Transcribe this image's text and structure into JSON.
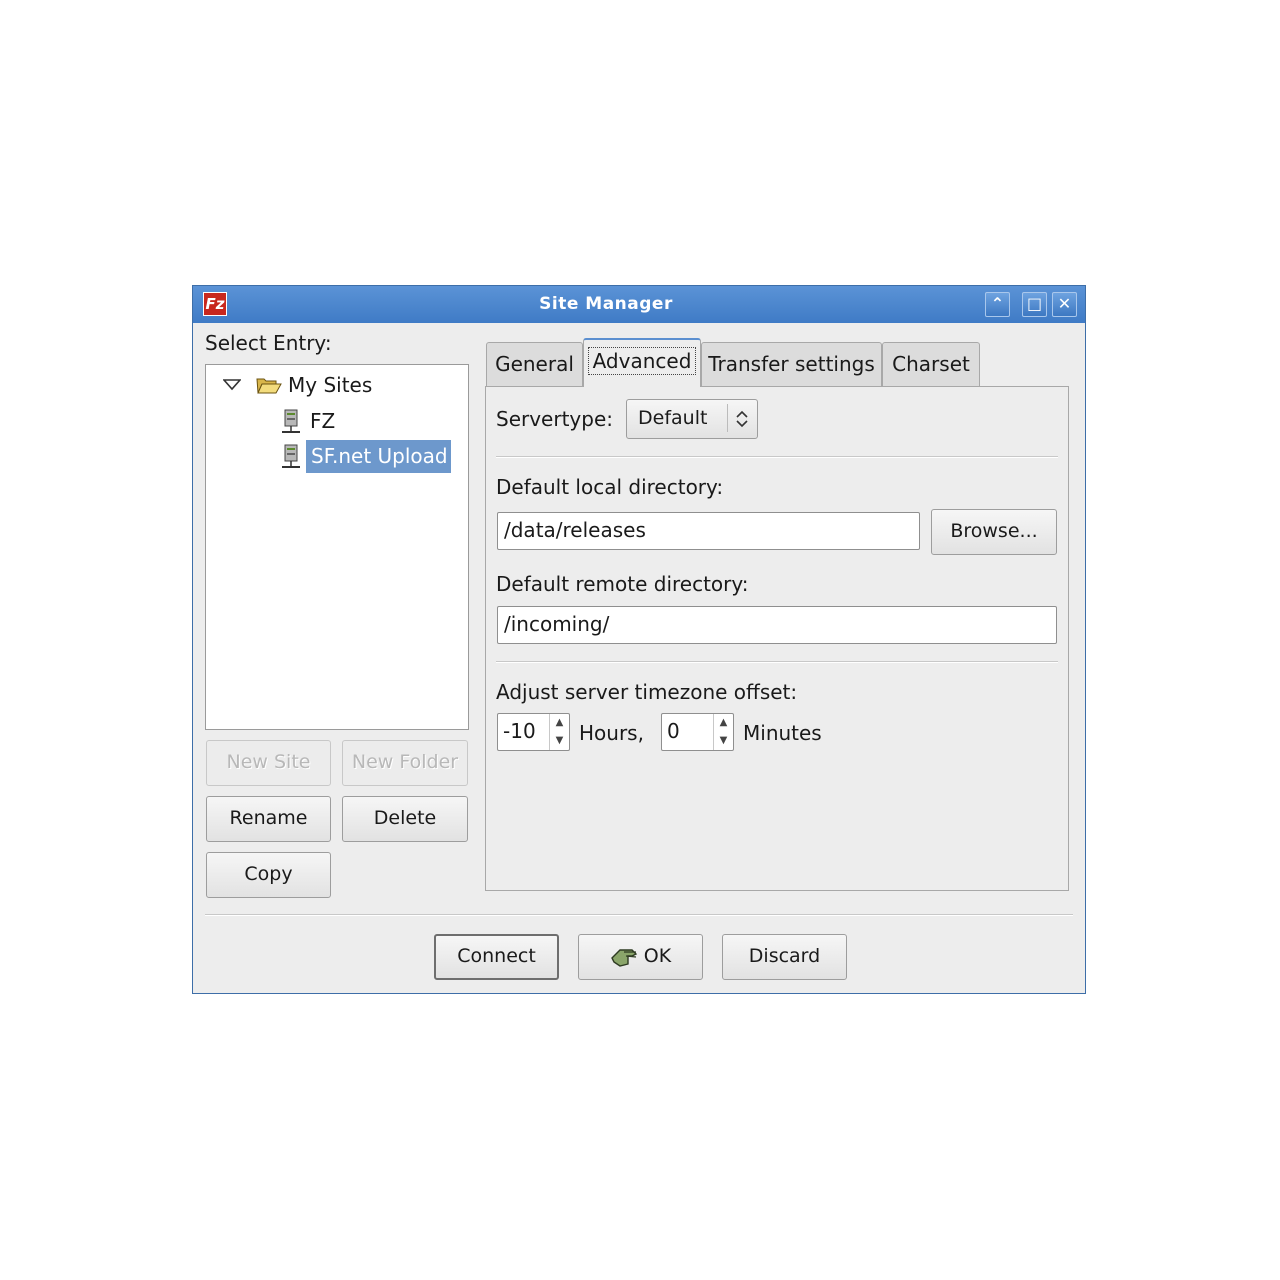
{
  "window": {
    "title": "Site Manager",
    "app_icon_label": "Fz",
    "controls": {
      "minimize": "⌃",
      "maximize": "□",
      "close": "✕"
    }
  },
  "left": {
    "select_entry_label": "Select Entry:",
    "tree": {
      "root": "My Sites",
      "items": [
        "FZ",
        "SF.net Upload"
      ],
      "selected_index": 1
    },
    "buttons": {
      "new_site": "New Site",
      "new_folder": "New Folder",
      "rename": "Rename",
      "delete": "Delete",
      "copy": "Copy"
    }
  },
  "tabs": [
    "General",
    "Advanced",
    "Transfer settings",
    "Charset"
  ],
  "active_tab": "Advanced",
  "advanced": {
    "servertype_label": "Servertype:",
    "servertype_value": "Default",
    "local_dir_label": "Default local directory:",
    "local_dir_value": "/data/releases",
    "browse_label": "Browse...",
    "remote_dir_label": "Default remote directory:",
    "remote_dir_value": "/incoming/",
    "timezone_label": "Adjust server timezone offset:",
    "hours_value": "-10",
    "hours_label": "Hours,",
    "minutes_value": "0",
    "minutes_label": "Minutes"
  },
  "footer": {
    "connect": "Connect",
    "ok": "OK",
    "discard": "Discard"
  },
  "colors": {
    "titlebar": "#4a86cf",
    "selection": "#6d98cc",
    "app_icon": "#c8281e"
  }
}
